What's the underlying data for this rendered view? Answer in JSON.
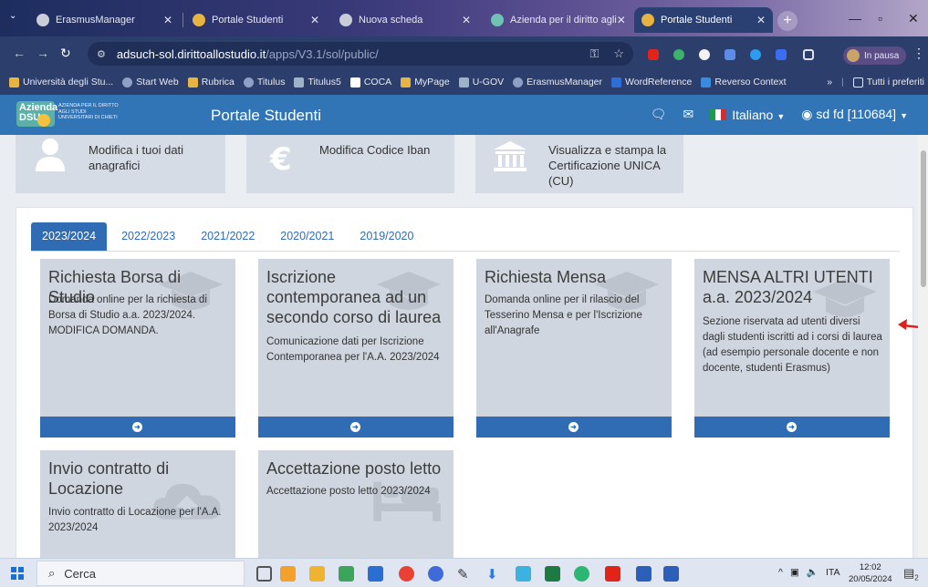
{
  "browser": {
    "tabs": [
      {
        "title": "ErasmusManager",
        "active": false
      },
      {
        "title": "Portale Studenti",
        "active": false
      },
      {
        "title": "Nuova scheda",
        "active": false
      },
      {
        "title": "Azienda per il diritto agli",
        "active": false
      },
      {
        "title": "Portale Studenti",
        "active": true
      }
    ],
    "url_host": "adsuch-sol.dirittoallostudio.it",
    "url_path": "/apps/V3.1/sol/public/",
    "profile_label": "In pausa",
    "bookmarks": [
      "Università degli Stu...",
      "Start Web",
      "Rubrica",
      "Titulus",
      "Titulus5",
      "COCA",
      "MyPage",
      "U-GOV",
      "ErasmusManager",
      "WordReference",
      "Reverso Context"
    ],
    "bookmarks_more": "»",
    "all_bookmarks": "Tutti i preferiti"
  },
  "header": {
    "logo_line1": "Azienda",
    "logo_line2": "DSU",
    "logo_text": "AZIENDA PER IL DIRITTO AGLI STUDI UNIVERSITARI DI CHIETI",
    "title": "Portale Studenti",
    "language": "Italiano",
    "user": "sd fd [110684]"
  },
  "quick_tiles": [
    {
      "label": "Modifica i tuoi dati anagrafici",
      "icon": "user-icon"
    },
    {
      "label": "Modifica Codice Iban",
      "icon": "euro-icon"
    },
    {
      "label": "Visualizza e stampa la Certificazione UNICA (CU)",
      "icon": "bank-icon"
    }
  ],
  "year_tabs": [
    {
      "label": "2023/2024",
      "active": true
    },
    {
      "label": "2022/2023",
      "active": false
    },
    {
      "label": "2021/2022",
      "active": false
    },
    {
      "label": "2020/2021",
      "active": false
    },
    {
      "label": "2019/2020",
      "active": false
    }
  ],
  "cards": [
    {
      "title": "Richiesta Borsa di Studio",
      "description": "Domanda online per la richiesta di Borsa di Studio a.a. 2023/2024. MODIFICA DOMANDA.",
      "icon": "graduation-cap-icon"
    },
    {
      "title": "Iscrizione contemporanea ad un secondo corso di laurea",
      "description": "Comunicazione dati per Iscrizione Contemporanea per l'A.A. 2023/2024",
      "icon": "graduation-cap-icon"
    },
    {
      "title": "Richiesta Mensa",
      "description": "Domanda online per il rilascio del Tesserino Mensa e per l'Iscrizione all'Anagrafe",
      "icon": "graduation-cap-icon"
    },
    {
      "title": "MENSA ALTRI UTENTI a.a. 2023/2024",
      "description": "Sezione riservata ad utenti diversi dagli studenti iscritti ad i corsi di laurea (ad esempio personale docente e non docente, studenti Erasmus)",
      "icon": "graduation-cap-icon"
    },
    {
      "title": "Invio contratto di Locazione",
      "description": "Invio contratto di Locazione per l'A.A. 2023/2024",
      "icon": "cloud-upload-icon"
    },
    {
      "title": "Accettazione posto letto",
      "description": "Accettazione posto letto 2023/2024",
      "icon": "bed-icon"
    }
  ],
  "taskbar": {
    "search_placeholder": "Cerca",
    "lang": "ITA",
    "time": "12:02",
    "date": "20/05/2024",
    "notifications": "2"
  },
  "colors": {
    "header_blue": "#3275b6",
    "card_footer_blue": "#2f6cb3",
    "card_bg": "#d0d6df",
    "annotation_red": "#e0201b"
  }
}
